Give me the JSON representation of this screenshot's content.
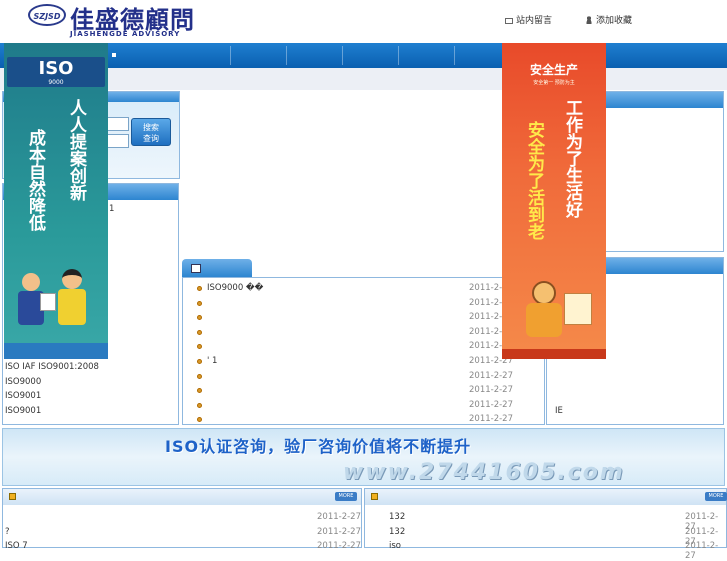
{
  "header": {
    "logo_mark": "SZJSD",
    "logo_cn": "佳盛德顧問",
    "logo_en": "JIASHENGDE ADVISORY",
    "link_message": "站内留言",
    "link_favorite": "添加收藏"
  },
  "search": {
    "button_label_1": "搜索",
    "button_label_2": "查询"
  },
  "left_banner": {
    "badge": "ISO",
    "badge_sub": "9000",
    "line1": "人人提案创新",
    "line2": "成本自然降低"
  },
  "right_banner": {
    "title": "安全生产",
    "subtitle": "安全第一 预防为主",
    "line1": "工作为了生活好",
    "line2": "安全为了活到老"
  },
  "left_list": {
    "partial_digit": "1",
    "items": [
      "ISO IAF  ISO9001:2008",
      "ISO9000",
      "ISO9001",
      "ISO9001"
    ]
  },
  "news": {
    "items": [
      {
        "title": "ISO9000    ��",
        "date": "2011-2-27"
      },
      {
        "title": "",
        "date": "2011-2-27"
      },
      {
        "title": "",
        "date": "2011-2-27"
      },
      {
        "title": "",
        "date": "2011-2-27"
      },
      {
        "title": "",
        "date": "2011-2-27"
      },
      {
        "title": "  ' 1",
        "date": "2011-2-27"
      },
      {
        "title": "",
        "date": "2011-2-27"
      },
      {
        "title": "",
        "date": "2011-2-27"
      },
      {
        "title": "",
        "date": "2011-2-27"
      },
      {
        "title": "",
        "date": "2011-2-27"
      }
    ]
  },
  "right_box": {
    "text": "IE"
  },
  "slogan": {
    "text": "ISO认证咨询，验厂咨询价值将不断提升",
    "url_text": "www.27441605.com"
  },
  "bottom_left": {
    "more": "MORE",
    "items": [
      {
        "title": "",
        "date": "2011-2-27"
      },
      {
        "title": "?",
        "date": "2011-2-27"
      },
      {
        "title": "ISO  7",
        "date": "2011-2-27"
      }
    ]
  },
  "bottom_right": {
    "more": "MORE",
    "items": [
      {
        "title": "132",
        "date": "2011-2-27"
      },
      {
        "title": "132",
        "date": "2011-2-27"
      },
      {
        "title": "iso",
        "date": "2011-2-27"
      }
    ]
  },
  "colors": {
    "nav_blue": "#0a5fb0",
    "logo_blue": "#23308a",
    "banner_left": "#2a9a9a",
    "banner_right": "#f06a3a"
  }
}
